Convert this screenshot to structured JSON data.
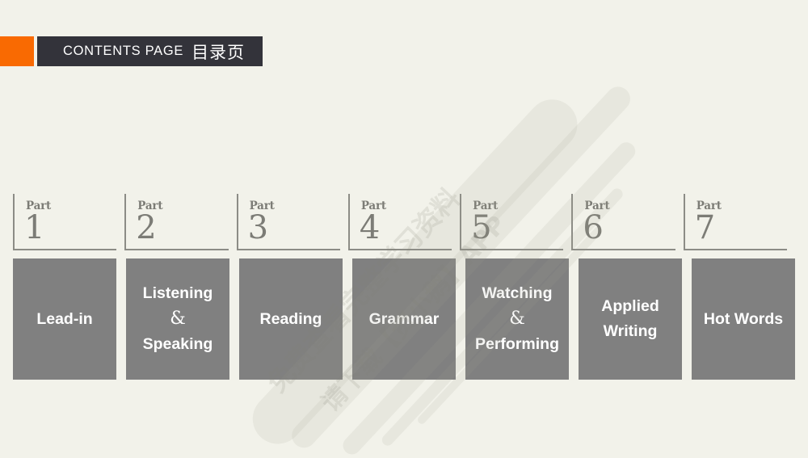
{
  "page": {
    "background_color": "#f2f2ea",
    "accent_color": "#f96a02",
    "panel_color": "#33333a",
    "box_color": "#808080",
    "rule_color": "#8c8c86"
  },
  "header": {
    "title_en": "CONTENTS PAGE",
    "title_zh": "目录页"
  },
  "watermark": {
    "line1": "免费查看完整学习资料",
    "line2": "请下载【资小鹅】APP"
  },
  "parts": [
    {
      "label": "Part",
      "number": "1",
      "title": "Lead-in",
      "lines": [
        "Lead-in"
      ]
    },
    {
      "label": "Part",
      "number": "2",
      "title": "Listening & Speaking",
      "lines": [
        "Listening",
        "&",
        "Speaking"
      ]
    },
    {
      "label": "Part",
      "number": "3",
      "title": "Reading",
      "lines": [
        "Reading"
      ]
    },
    {
      "label": "Part",
      "number": "4",
      "title": "Grammar",
      "lines": [
        "Grammar"
      ]
    },
    {
      "label": "Part",
      "number": "5",
      "title": "Watching & Performing",
      "lines": [
        "Watching",
        "&",
        "Performing"
      ]
    },
    {
      "label": "Part",
      "number": "6",
      "title": "Applied Writing",
      "lines": [
        "Applied",
        "Writing"
      ]
    },
    {
      "label": "Part",
      "number": "7",
      "title": "Hot Words",
      "lines": [
        "Hot Words"
      ]
    }
  ]
}
